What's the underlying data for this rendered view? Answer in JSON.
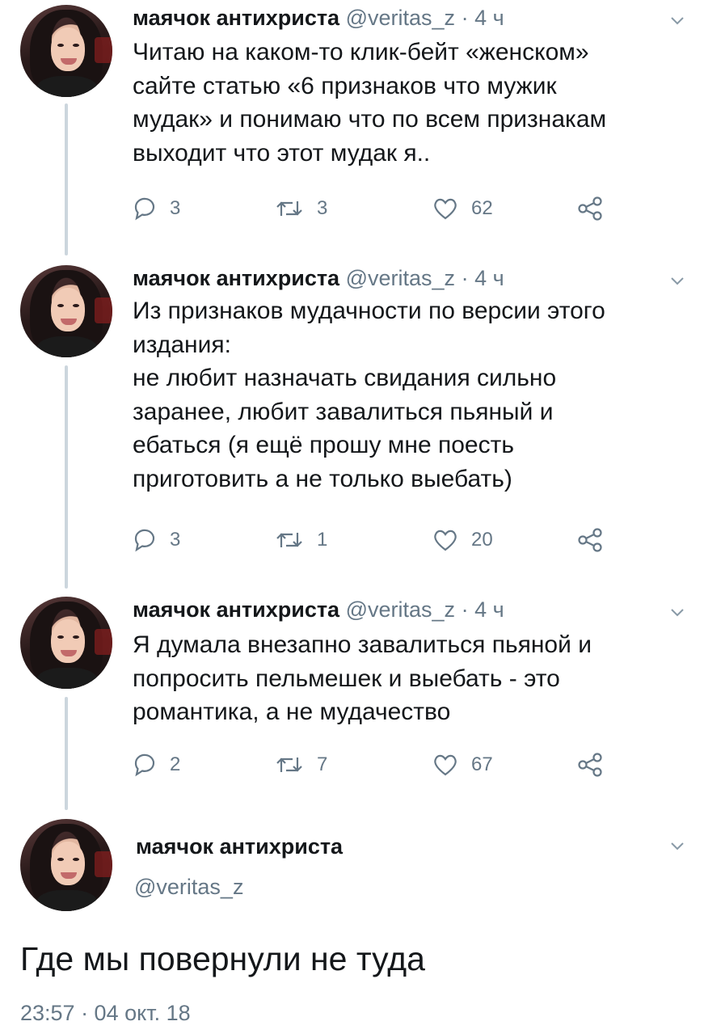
{
  "thread": [
    {
      "name": "маячок антихриста",
      "handle": "@veritas_z",
      "time_sep": "·",
      "time": "4 ч",
      "lines": [
        "Читаю на каком-то клик-бейт «женском»",
        "сайте статью «6 признаков что мужик",
        "мудак» и понимаю что по всем признакам",
        "выходит что этот мудак я.."
      ],
      "replies": "3",
      "retweets": "3",
      "likes": "62"
    },
    {
      "name": "маячок антихриста",
      "handle": "@veritas_z",
      "time_sep": "·",
      "time": "4 ч",
      "lines": [
        "Из признаков мудачности по версии этого",
        "издания:",
        "не любит назначать  свидания сильно",
        "заранее, любит завалиться пьяный и",
        "ебаться (я ещё прошу мне поесть",
        "приготовить а не только выебать)"
      ],
      "replies": "3",
      "retweets": "1",
      "likes": "20"
    },
    {
      "name": "маячок антихриста",
      "handle": "@veritas_z",
      "time_sep": "·",
      "time": "4 ч",
      "lines": [
        "Я думала внезапно завалиться пьяной и",
        "попросить пельмешек и выебать - это",
        "романтика, а не мудачество"
      ],
      "replies": "2",
      "retweets": "7",
      "likes": "67"
    }
  ],
  "main": {
    "name": "маячок антихриста",
    "handle": "@veritas_z",
    "text": "Где мы повернули не туда",
    "timestamp": "23:57 · 04 окт. 18"
  },
  "icons": {
    "reply": "reply-icon",
    "retweet": "retweet-icon",
    "like": "heart-icon",
    "share": "share-icon",
    "menu": "chevron-down-icon"
  },
  "colors": {
    "text": "#14171a",
    "secondary": "#657786",
    "thread_line": "#ccd6dd"
  }
}
